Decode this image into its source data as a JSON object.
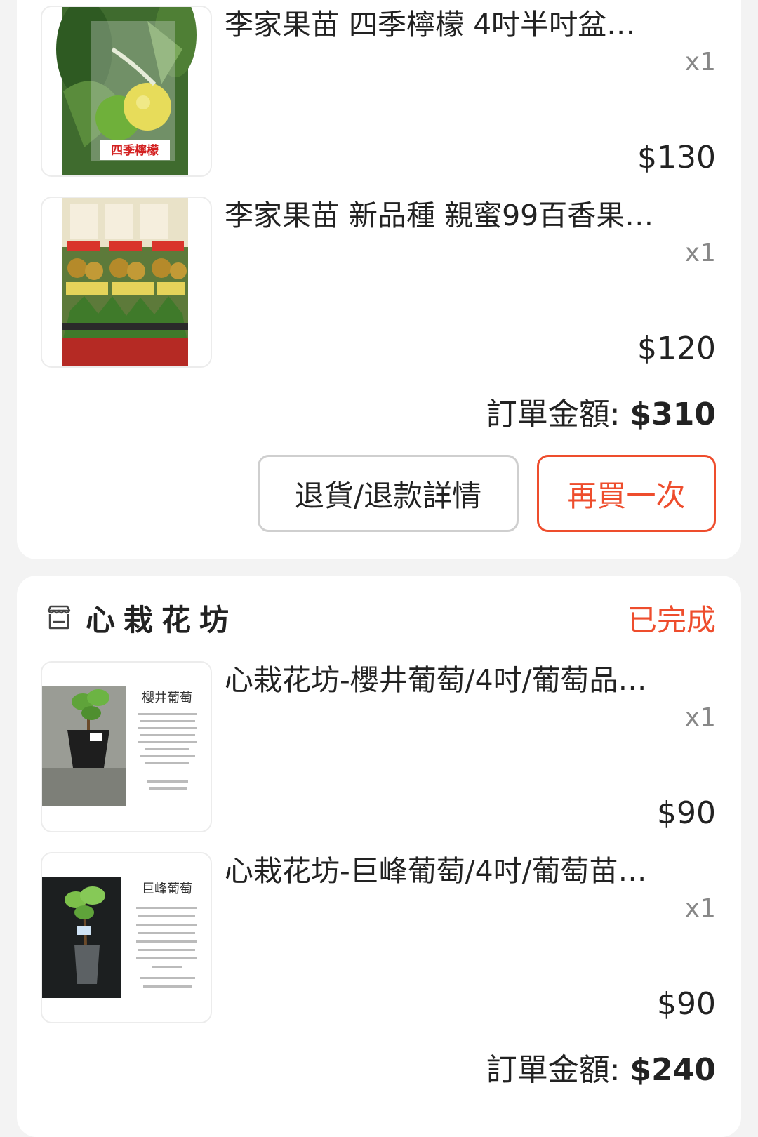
{
  "orders": [
    {
      "items": [
        {
          "name": "李家果苗 四季檸檬 4吋半吋盆…",
          "qty": "x1",
          "price": "$130",
          "image_icon": "lemon-plant-photo",
          "image_tag_text": "四季檸檬"
        },
        {
          "name": "李家果苗 新品種 親蜜99百香果…",
          "qty": "x1",
          "price": "$120",
          "image_icon": "passion-fruit-seedlings-photo"
        }
      ],
      "total_label": "訂單金額: ",
      "total_amount": "$310",
      "actions": {
        "return_refund": "退貨/退款詳情",
        "buy_again": "再買一次"
      }
    },
    {
      "shop_name": "心栽花坊",
      "status": "已完成",
      "items": [
        {
          "name": "心栽花坊-櫻井葡萄/4吋/葡萄品…",
          "qty": "x1",
          "price": "$90",
          "image_icon": "grape-seedling-photo",
          "image_caption": "櫻井葡萄"
        },
        {
          "name": "心栽花坊-巨峰葡萄/4吋/葡萄苗…",
          "qty": "x1",
          "price": "$90",
          "image_icon": "grape-seedling-photo",
          "image_caption": "巨峰葡萄"
        }
      ],
      "total_label": "訂單金額: ",
      "total_amount": "$240"
    }
  ],
  "colors": {
    "accent": "#ee4d2d",
    "background": "#f3f3f3",
    "card": "#ffffff",
    "muted_text": "#888888",
    "button_border": "#cfcfcf"
  }
}
